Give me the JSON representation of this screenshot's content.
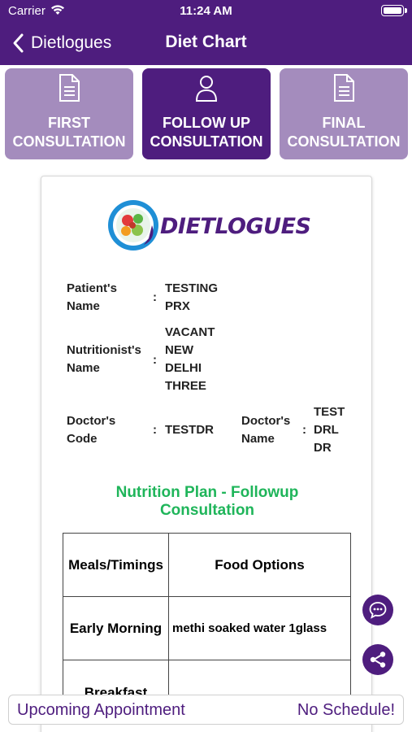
{
  "status_bar": {
    "carrier": "Carrier",
    "time": "11:24 AM"
  },
  "nav": {
    "back_label": "Dietlogues",
    "title": "Diet Chart"
  },
  "tabs": [
    {
      "line1": "FIRST",
      "line2": "CONSULTATION",
      "icon": "document-icon",
      "active": false
    },
    {
      "line1": "FOLLOW UP",
      "line2": "CONSULTATION",
      "icon": "person-icon",
      "active": true
    },
    {
      "line1": "FINAL",
      "line2": "CONSULTATION",
      "icon": "document-icon",
      "active": false
    }
  ],
  "card": {
    "logo_text": "DIETLOGUES",
    "patient": {
      "label1": "Patient's",
      "label2": "Name",
      "value1": "TESTING",
      "value2": "PRX"
    },
    "nutritionist": {
      "label1": "Nutritionist's",
      "label2": "Name",
      "value1": "VACANT",
      "value2": "NEW",
      "value3": "DELHI",
      "value4": "THREE"
    },
    "doctor_code": {
      "label1": "Doctor's",
      "label2": "Code",
      "value": "TESTDR"
    },
    "doctor_name": {
      "label1": "Doctor's",
      "label2": "Name",
      "value1": "TEST",
      "value2": "DRL",
      "value3": "DR"
    },
    "plan_title1": "Nutrition Plan - Followup",
    "plan_title2": "Consultation",
    "table": {
      "headers": [
        "Meals/Timings",
        "Food Options"
      ],
      "rows": [
        {
          "meal": "Early Morning",
          "food": "methi soaked water 1glass"
        },
        {
          "meal": "Breakfast",
          "food": ""
        }
      ]
    }
  },
  "bottom_bar": {
    "left": "Upcoming Appointment",
    "right": "No Schedule!"
  },
  "colors": {
    "primary": "#4e1d7e",
    "tab_inactive": "#a48cbd",
    "accent_green": "#1fb55a"
  }
}
